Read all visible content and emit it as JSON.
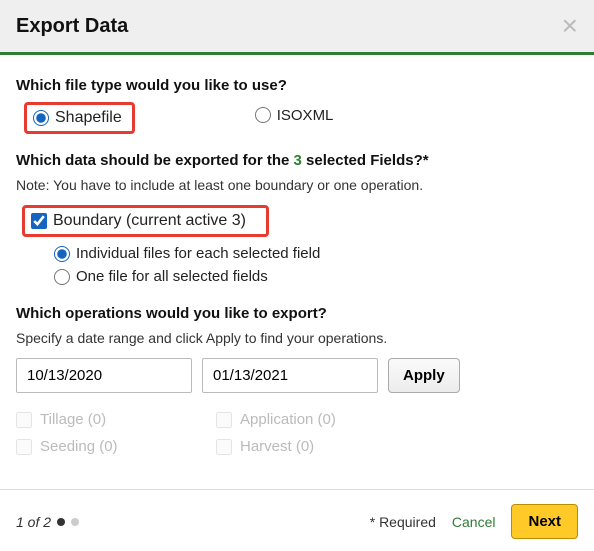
{
  "header": {
    "title": "Export Data"
  },
  "q1": {
    "title": "Which file type would you like to use?",
    "options": {
      "shapefile": "Shapefile",
      "isoxml": "ISOXML"
    }
  },
  "q2": {
    "title_pre": "Which data should be exported for the ",
    "title_count": "3",
    "title_post": " selected Fields?*",
    "note": "Note: You have to include at least one boundary or one operation.",
    "boundary_label": "Boundary (current active 3)",
    "sub": {
      "individual": "Individual files for each selected field",
      "onefile": "One file for all selected fields"
    }
  },
  "q3": {
    "title": "Which operations would you like to export?",
    "note": "Specify a date range and click Apply to find your operations.",
    "date_start": "10/13/2020",
    "date_end": "01/13/2021",
    "apply": "Apply",
    "ops": {
      "tillage": "Tillage (0)",
      "application": "Application (0)",
      "seeding": "Seeding (0)",
      "harvest": "Harvest (0)"
    }
  },
  "footer": {
    "pager": "1 of 2",
    "required": "* Required",
    "cancel": "Cancel",
    "next": "Next"
  }
}
